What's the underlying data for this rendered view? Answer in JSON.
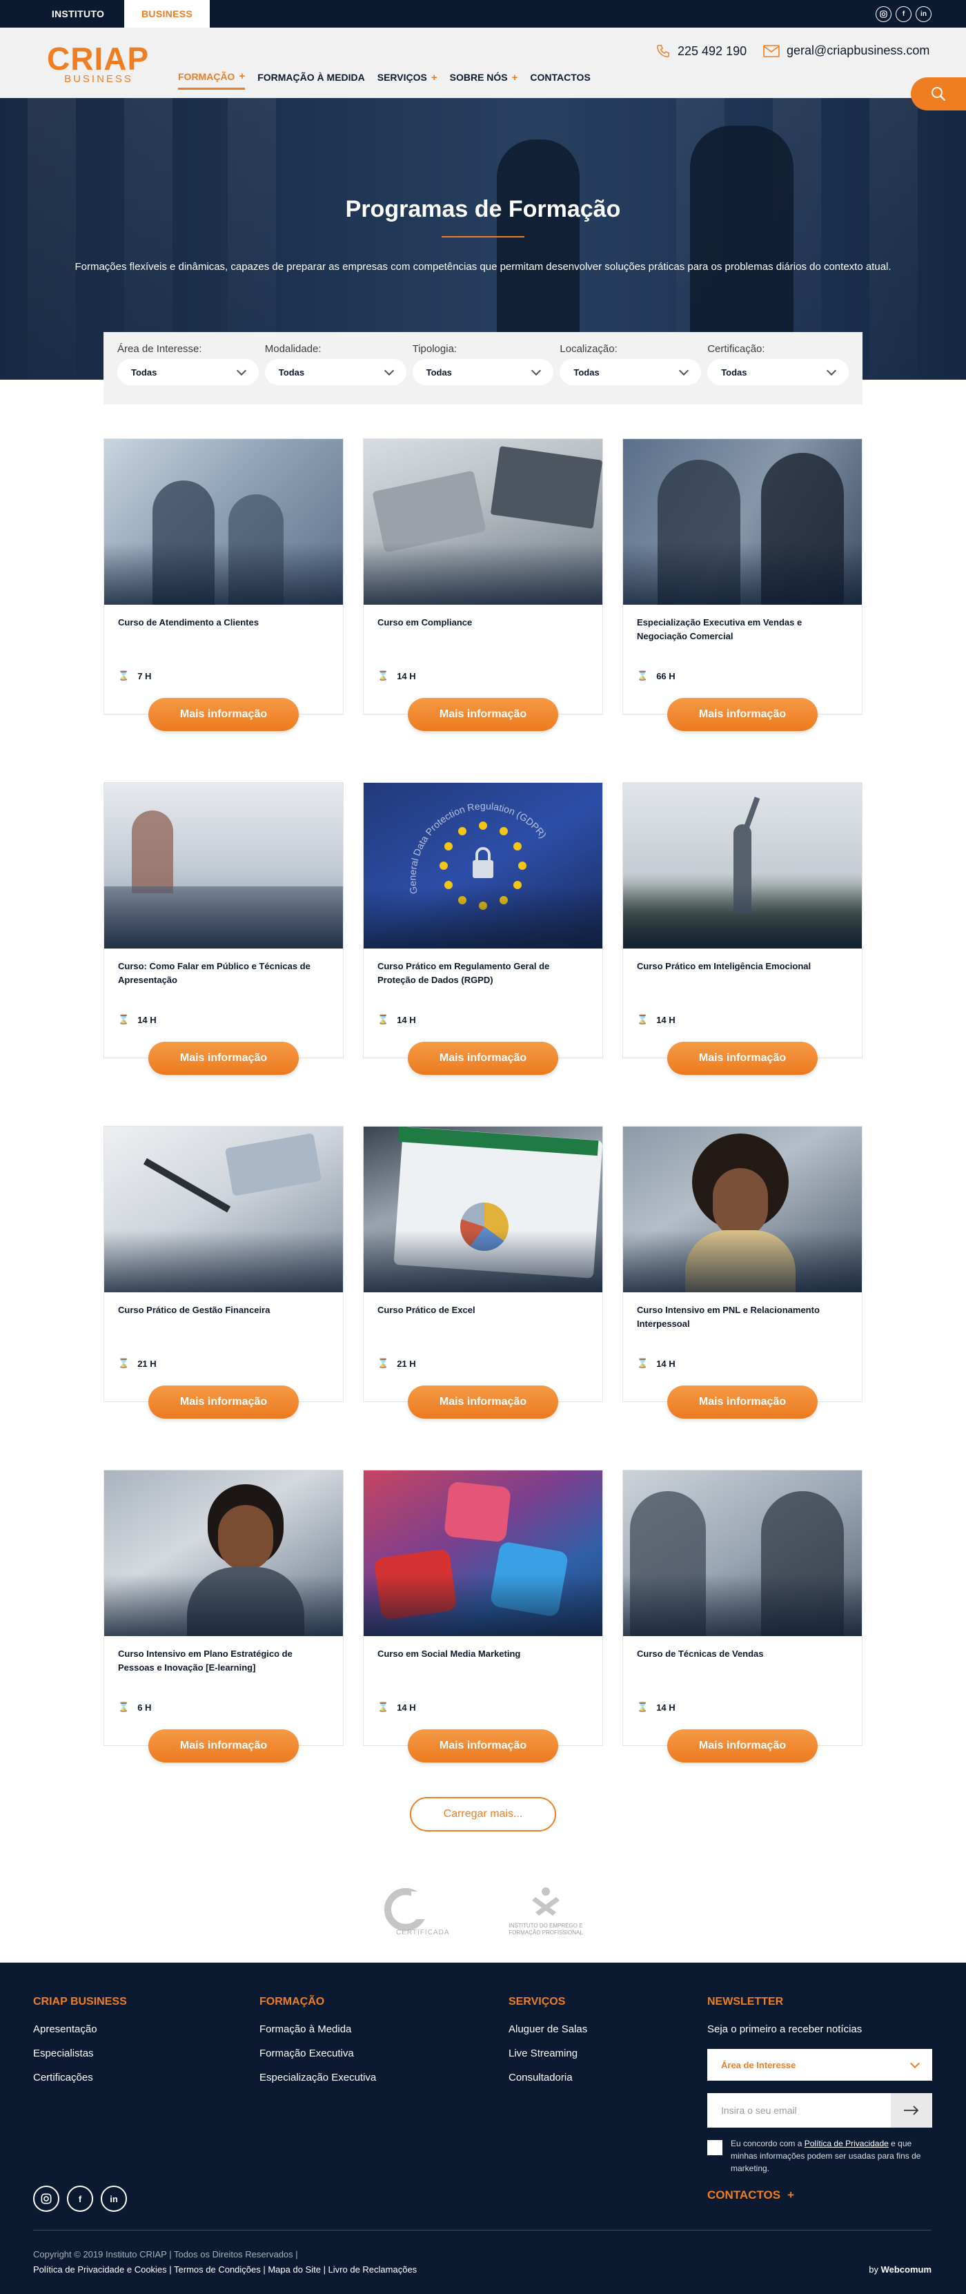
{
  "topbar": {
    "tabs": [
      {
        "label": "INSTITUTO"
      },
      {
        "label": "BUSINESS"
      }
    ],
    "socials": [
      "instagram-icon",
      "facebook-icon",
      "linkedin-icon"
    ]
  },
  "header": {
    "logo_main": "CRIAP",
    "logo_sub": "BUSINESS",
    "nav": [
      {
        "label": "FORMAÇÃO",
        "has_plus": true,
        "active": true
      },
      {
        "label": "FORMAÇÃO À MEDIDA",
        "has_plus": false
      },
      {
        "label": "SERVIÇOS",
        "has_plus": true
      },
      {
        "label": "SOBRE NÓS",
        "has_plus": true
      },
      {
        "label": "CONTACTOS",
        "has_plus": false
      }
    ],
    "phone": "225 492 190",
    "email": "geral@criapbusiness.com"
  },
  "hero": {
    "title": "Programas de Formação",
    "subtitle": "Formações flexíveis e dinâmicas, capazes de preparar as empresas com competências que permitam desenvolver soluções práticas para os problemas diários do contexto atual."
  },
  "filters": [
    {
      "label": "Área de Interesse:",
      "value": "Todas"
    },
    {
      "label": "Modalidade:",
      "value": "Todas"
    },
    {
      "label": "Tipologia:",
      "value": "Todas"
    },
    {
      "label": "Localização:",
      "value": "Todas"
    },
    {
      "label": "Certificação:",
      "value": "Todas"
    }
  ],
  "courses": [
    {
      "title": "Curso de Atendimento a Clientes",
      "duration": "7 H",
      "button": "Mais informação"
    },
    {
      "title": "Curso em Compliance",
      "duration": "14 H",
      "button": "Mais informação"
    },
    {
      "title": "Especialização Executiva em Vendas e Negociação Comercial",
      "duration": "66 H",
      "button": "Mais informação"
    },
    {
      "title": "Curso: Como Falar em Público e Técnicas de Apresentação",
      "duration": "14 H",
      "button": "Mais informação"
    },
    {
      "title": "Curso Prático em Regulamento Geral de Proteção de Dados (RGPD)",
      "duration": "14 H",
      "button": "Mais informação"
    },
    {
      "title": "Curso Prático em Inteligência Emocional",
      "duration": "14 H",
      "button": "Mais informação"
    },
    {
      "title": "Curso Prático de Gestão Financeira",
      "duration": "21 H",
      "button": "Mais informação"
    },
    {
      "title": "Curso Prático de Excel",
      "duration": "21 H",
      "button": "Mais informação"
    },
    {
      "title": "Curso Intensivo em PNL e Relacionamento Interpessoal",
      "duration": "14 H",
      "button": "Mais informação"
    },
    {
      "title": "Curso Intensivo em Plano Estratégico de Pessoas e Inovação [E-learning]",
      "duration": "6 H",
      "button": "Mais informação"
    },
    {
      "title": "Curso em Social Media Marketing",
      "duration": "14 H",
      "button": "Mais informação"
    },
    {
      "title": "Curso de Técnicas de Vendas",
      "duration": "14 H",
      "button": "Mais informação"
    }
  ],
  "gdpr_image_text": "General Data Protection Regulation (GDPR)",
  "load_more": "Carregar mais...",
  "partners": {
    "a_text": "CERTIFICADA",
    "b_text": "INSTITUTO DO EMPREGO E FORMAÇÃO PROFISSIONAL"
  },
  "footer": {
    "col1": {
      "title": "CRIAP BUSINESS",
      "links": [
        "Apresentação",
        "Especialistas",
        "Certificações"
      ]
    },
    "col2": {
      "title": "FORMAÇÃO",
      "links": [
        "Formação à Medida",
        "Formação Executiva",
        "Especialização Executiva"
      ]
    },
    "col3": {
      "title": "SERVIÇOS",
      "links": [
        "Aluguer de Salas",
        "Live Streaming",
        "Consultadoria"
      ]
    },
    "newsletter": {
      "title": "NEWSLETTER",
      "text": "Seja o primeiro a receber notícias",
      "select_value": "Área de Interesse",
      "email_placeholder": "Insira o seu email",
      "consent_pre": "Eu concordo com a ",
      "consent_link": "Política de Privacidade",
      "consent_post": " e que minhas informações podem ser usadas para fins de marketing.",
      "contacts": "CONTACTOS"
    },
    "copyright": "Copyright © 2019 Instituto CRIAP | Todos os Direitos Reservados |",
    "legal": "Política de Privacidade e Cookies | Termos de Condições | Mapa do Site | Livro de Reclamações",
    "by_prefix": "by ",
    "by_name": "Webcomum"
  },
  "colors": {
    "accent": "#ef7d22",
    "navy": "#0b1a30"
  }
}
